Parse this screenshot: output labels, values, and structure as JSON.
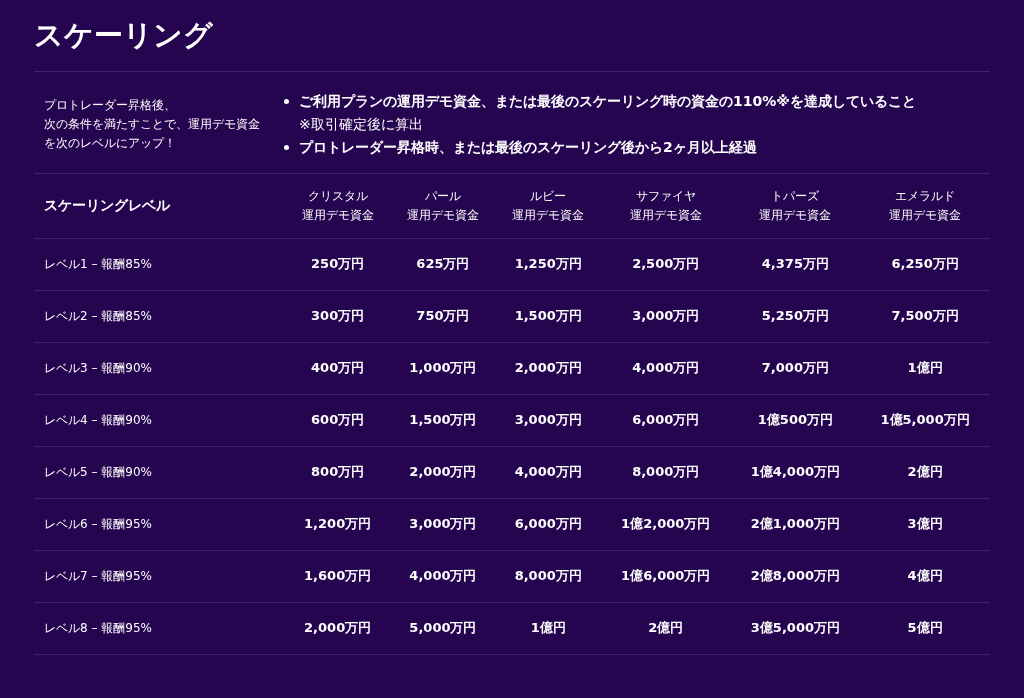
{
  "title": "スケーリング",
  "conditions": {
    "intro_lines": [
      "プロトレーダー昇格後、",
      "次の条件を満たすことで、運用デモ資金",
      "を次のレベルにアップ！"
    ],
    "items": [
      {
        "text": "ご利用プランの運用デモ資金、または最後のスケーリング時の資金の110%※を達成していること",
        "note": "※取引確定後に算出"
      },
      {
        "text": "プロトレーダー昇格時、または最後のスケーリング後から2ヶ月以上経過"
      }
    ]
  },
  "table": {
    "corner": "スケーリングレベル",
    "columns": [
      {
        "name": "クリスタル",
        "sub": "運用デモ資金"
      },
      {
        "name": "パール",
        "sub": "運用デモ資金"
      },
      {
        "name": "ルビー",
        "sub": "運用デモ資金"
      },
      {
        "name": "サファイヤ",
        "sub": "運用デモ資金"
      },
      {
        "name": "トパーズ",
        "sub": "運用デモ資金"
      },
      {
        "name": "エメラルド",
        "sub": "運用デモ資金"
      }
    ],
    "rows": [
      {
        "level": "レベル1 – 報酬85%",
        "values": [
          "250万円",
          "625万円",
          "1,250万円",
          "2,500万円",
          "4,375万円",
          "6,250万円"
        ]
      },
      {
        "level": "レベル2 – 報酬85%",
        "values": [
          "300万円",
          "750万円",
          "1,500万円",
          "3,000万円",
          "5,250万円",
          "7,500万円"
        ]
      },
      {
        "level": "レベル3 – 報酬90%",
        "values": [
          "400万円",
          "1,000万円",
          "2,000万円",
          "4,000万円",
          "7,000万円",
          "1億円"
        ]
      },
      {
        "level": "レベル4 – 報酬90%",
        "values": [
          "600万円",
          "1,500万円",
          "3,000万円",
          "6,000万円",
          "1億500万円",
          "1億5,000万円"
        ]
      },
      {
        "level": "レベル5 – 報酬90%",
        "values": [
          "800万円",
          "2,000万円",
          "4,000万円",
          "8,000万円",
          "1億4,000万円",
          "2億円"
        ]
      },
      {
        "level": "レベル6 – 報酬95%",
        "values": [
          "1,200万円",
          "3,000万円",
          "6,000万円",
          "1億2,000万円",
          "2億1,000万円",
          "3億円"
        ]
      },
      {
        "level": "レベル7 – 報酬95%",
        "values": [
          "1,600万円",
          "4,000万円",
          "8,000万円",
          "1億6,000万円",
          "2億8,000万円",
          "4億円"
        ]
      },
      {
        "level": "レベル8 – 報酬95%",
        "values": [
          "2,000万円",
          "5,000万円",
          "1億円",
          "2億円",
          "3億5,000万円",
          "5億円"
        ]
      }
    ]
  }
}
